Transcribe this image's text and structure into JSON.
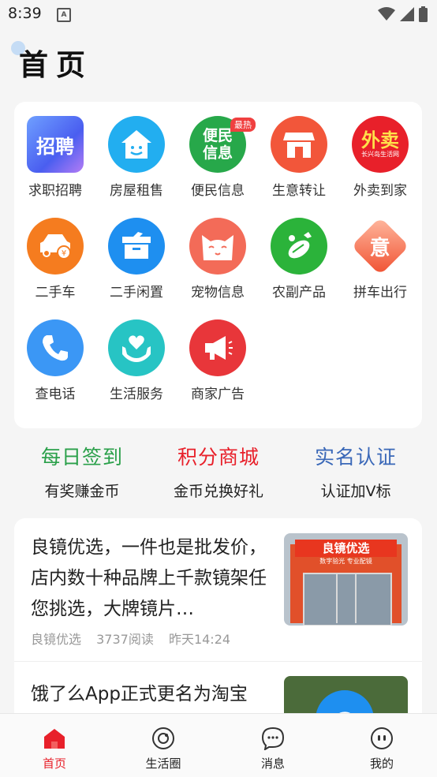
{
  "status": {
    "time": "8:39",
    "notif_icon": "A"
  },
  "header": {
    "title": "首页"
  },
  "grid": [
    {
      "label": "求职招聘",
      "icon": "recruit-icon",
      "icon_text": "招聘",
      "color": "#4a78f0"
    },
    {
      "label": "房屋租售",
      "icon": "house-icon",
      "color": "#22aef0"
    },
    {
      "label": "便民信息",
      "icon": "convenience-info-icon",
      "icon_text": "便民\n信息",
      "badge": "最热",
      "color": "#27a84a"
    },
    {
      "label": "生意转让",
      "icon": "shop-icon",
      "color": "#f2563a"
    },
    {
      "label": "外卖到家",
      "icon": "takeout-icon",
      "icon_text": "外卖",
      "icon_subtext": "长兴岛生活网",
      "color": "#e8202a"
    },
    {
      "label": "二手车",
      "icon": "car-icon",
      "color": "#f57c1f"
    },
    {
      "label": "二手闲置",
      "icon": "box-icon",
      "color": "#1e8ff0"
    },
    {
      "label": "宠物信息",
      "icon": "cat-icon",
      "color": "#f36b58"
    },
    {
      "label": "农副产品",
      "icon": "vegetable-icon",
      "color": "#2bb33a"
    },
    {
      "label": "拼车出行",
      "icon": "carpool-icon",
      "icon_text": "意",
      "color": "#f05030"
    },
    {
      "label": "查电话",
      "icon": "phone-icon",
      "color": "#3b97f5"
    },
    {
      "label": "生活服务",
      "icon": "heart-hands-icon",
      "color": "#27c4c4"
    },
    {
      "label": "商家广告",
      "icon": "megaphone-icon",
      "color": "#e8363a"
    }
  ],
  "promos": [
    {
      "title": "每日签到",
      "subtitle": "有奖赚金币",
      "color": "#2aa04a"
    },
    {
      "title": "积分商城",
      "subtitle": "金币兑换好礼",
      "color": "#e8202a"
    },
    {
      "title": "实名认证",
      "subtitle": "认证加V标",
      "color": "#3a68b8"
    }
  ],
  "articles": [
    {
      "title": "良镜优选，一件也是批发价，店内数十种品牌上千款镜架任您挑选，大牌镜片…",
      "source": "良镜优选",
      "reads": "3737阅读",
      "time": "昨天14:24",
      "thumb_text": "良镜优选",
      "thumb_sub": "数字验光  专业配镜"
    },
    {
      "title": "饿了么App正式更名为淘宝",
      "thumb_text": "e"
    }
  ],
  "tabs": [
    {
      "label": "首页",
      "icon": "home-icon",
      "active": true
    },
    {
      "label": "生活圈",
      "icon": "life-circle-icon",
      "active": false
    },
    {
      "label": "消息",
      "icon": "message-icon",
      "active": false
    },
    {
      "label": "我的",
      "icon": "profile-icon",
      "active": false
    }
  ],
  "colors": {
    "accent": "#e8202a",
    "active_tab": "#e8202a"
  }
}
